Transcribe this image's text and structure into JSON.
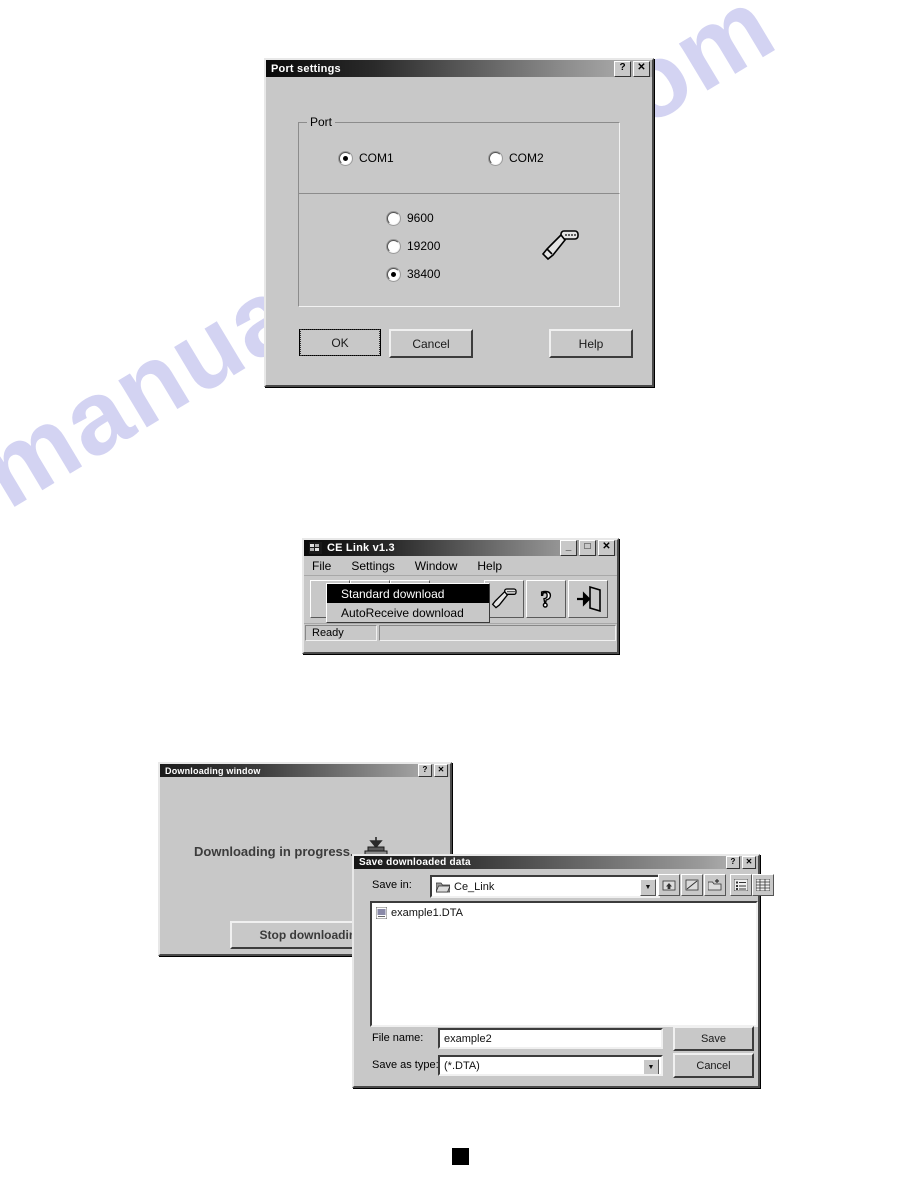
{
  "page": {
    "watermark_text": "manualshive.com",
    "watermark_color": "#ccccf0",
    "page_marker": ""
  },
  "port_settings": {
    "title": "Port settings",
    "help_button": "?",
    "close_button": "✕",
    "port_group_label": "Port",
    "port_options": [
      {
        "label": "COM1",
        "selected": true
      },
      {
        "label": "COM2",
        "selected": false
      }
    ],
    "baud_options": [
      {
        "label": "9600",
        "selected": false
      },
      {
        "label": "19200",
        "selected": false
      },
      {
        "label": "38400",
        "selected": true
      }
    ],
    "connector_icon": "serial-connector-icon",
    "buttons": {
      "ok": "OK",
      "cancel": "Cancel",
      "help": "Help"
    }
  },
  "ce_link": {
    "title": "CE Link v1.3",
    "minimize_button": "_",
    "maximize_button": "□",
    "close_button": "✕",
    "menus": [
      "File",
      "Settings",
      "Window",
      "Help"
    ],
    "open_menu": {
      "items": [
        {
          "label": "Standard download",
          "selected": true
        },
        {
          "label": "AutoReceive download",
          "selected": false
        }
      ]
    },
    "toolbar_icons": [
      "serial-connector-icon",
      "question-mark-icon",
      "exit-door-icon"
    ],
    "status_text": "Ready"
  },
  "downloading_window": {
    "title": "Downloading window",
    "help_button": "?",
    "close_button": "✕",
    "progress_text": "Downloading in progress...",
    "download_icon": "download-device-icon",
    "stop_button": "Stop downloading"
  },
  "save_dialog": {
    "title": "Save downloaded data",
    "help_button": "?",
    "close_button": "✕",
    "save_in_label": "Save in:",
    "save_in_value": "Ce_Link",
    "toolbar_icons": [
      "up-one-level-icon",
      "desktop-icon",
      "new-folder-icon",
      "list-view-icon",
      "details-view-icon"
    ],
    "files": [
      {
        "name": "example1.DTA",
        "icon": "dta-file-icon"
      }
    ],
    "file_name_label": "File name:",
    "file_name_value": "example2",
    "save_as_type_label": "Save as type:",
    "save_as_type_value": "(*.DTA)",
    "buttons": {
      "save": "Save",
      "cancel": "Cancel"
    }
  }
}
